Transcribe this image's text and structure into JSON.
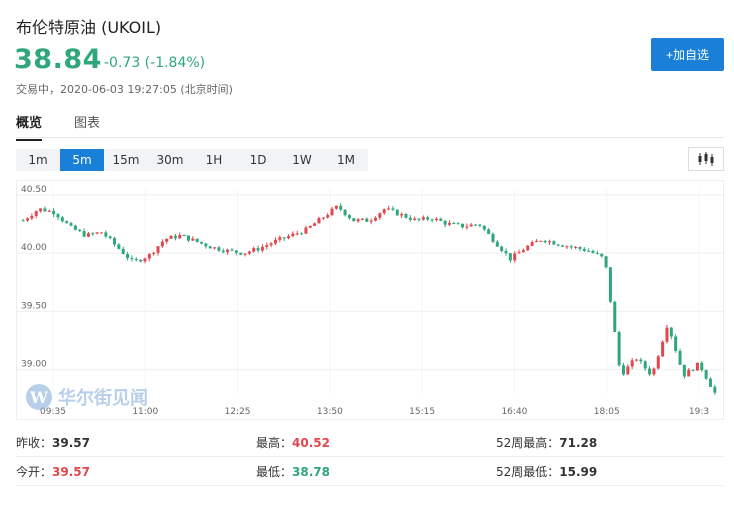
{
  "header": {
    "title": "布伦特原油 (UKOIL)",
    "price": "38.84",
    "change": "-0.73 (-1.84%)",
    "status": "交易中，2020-06-03 19:27:05 (北京时间)",
    "add_button": "+加自选"
  },
  "tabs": [
    {
      "label": "概览",
      "active": true
    },
    {
      "label": "图表",
      "active": false
    }
  ],
  "intervals": [
    {
      "label": "1m",
      "active": false
    },
    {
      "label": "5m",
      "active": true
    },
    {
      "label": "15m",
      "active": false
    },
    {
      "label": "30m",
      "active": false
    },
    {
      "label": "1H",
      "active": false
    },
    {
      "label": "1D",
      "active": false
    },
    {
      "label": "1W",
      "active": false
    },
    {
      "label": "1M",
      "active": false
    }
  ],
  "chart_type_icon": "candlestick-icon",
  "watermark": "华尔街见闻",
  "colors": {
    "up": "#e0484d",
    "down": "#2fa77a",
    "accent": "#1a7fd6"
  },
  "chart_data": {
    "type": "candlestick",
    "y_ticks": [
      "40.50",
      "40.00",
      "39.50",
      "39.00"
    ],
    "ylim": [
      38.8,
      40.55
    ],
    "x_ticks": [
      "09:35",
      "11:00",
      "12:25",
      "13:50",
      "15:15",
      "16:40",
      "18:05",
      "19:3"
    ],
    "grid": true,
    "approx_path": [
      40.28,
      40.38,
      40.35,
      40.22,
      40.15,
      40.18,
      40.05,
      39.92,
      39.98,
      40.12,
      40.15,
      40.1,
      40.05,
      40.02,
      40.0,
      40.04,
      40.1,
      40.15,
      40.2,
      40.3,
      40.4,
      40.28,
      40.28,
      40.38,
      40.33,
      40.28,
      40.3,
      40.25,
      40.23,
      40.25,
      40.1,
      39.95,
      40.05,
      40.12,
      40.08,
      40.05,
      40.02,
      39.95,
      38.95,
      39.1,
      38.95,
      39.4,
      38.95,
      39.05,
      38.8
    ]
  },
  "stats": {
    "prev_close_label": "昨收：",
    "prev_close": "39.57",
    "high_label": "最高：",
    "high": "40.52",
    "w52_high_label": "52周最高：",
    "w52_high": "71.28",
    "open_label": "今开：",
    "open": "39.57",
    "low_label": "最低：",
    "low": "38.78",
    "w52_low_label": "52周最低：",
    "w52_low": "15.99"
  }
}
